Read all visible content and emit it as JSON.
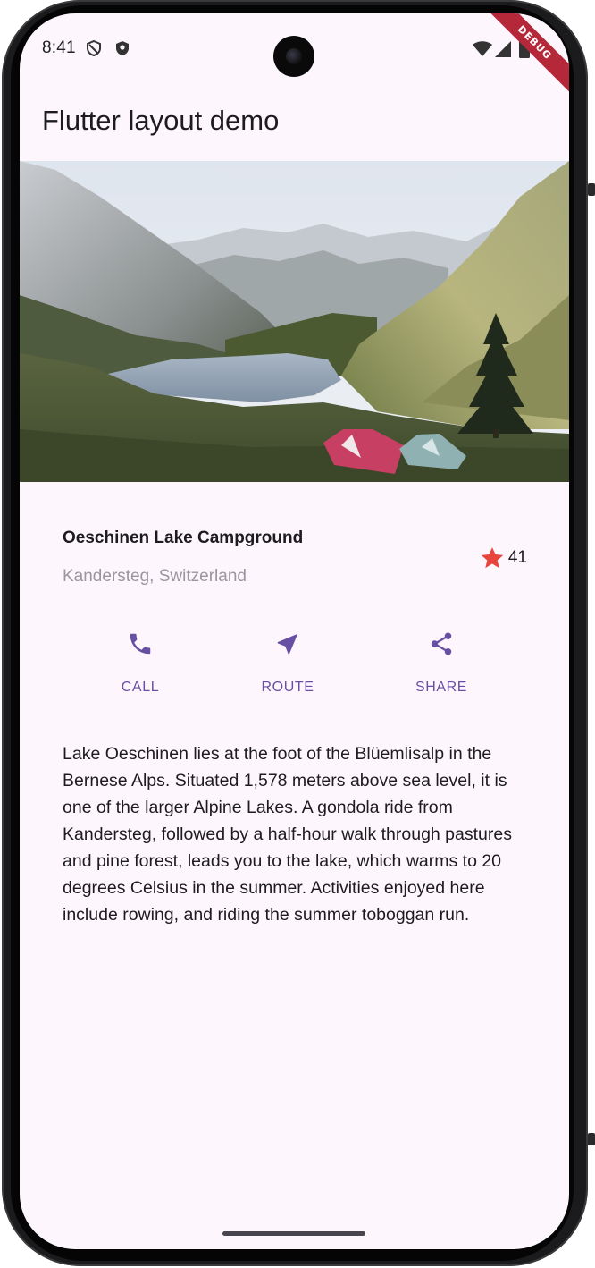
{
  "status_bar": {
    "time": "8:41",
    "left_icons": [
      "shield-outline-icon",
      "shield-filled-icon"
    ],
    "right_icons": [
      "wifi-icon",
      "cellular-icon",
      "battery-icon"
    ],
    "debug_banner": "DEBUG"
  },
  "app_bar": {
    "title": "Flutter layout demo"
  },
  "hero_image": {
    "subject": "mountain lake with tents"
  },
  "title_section": {
    "name": "Oeschinen Lake Campground",
    "location": "Kandersteg, Switzerland",
    "rating_icon": "star-icon",
    "rating_count": "41"
  },
  "buttons": [
    {
      "label": "CALL",
      "icon": "phone-icon"
    },
    {
      "label": "ROUTE",
      "icon": "navigation-icon"
    },
    {
      "label": "SHARE",
      "icon": "share-icon"
    }
  ],
  "description": "Lake Oeschinen lies at the foot of the Blüemlisalp in the Bernese Alps. Situated 1,578 meters above sea level, it is one of the larger Alpine Lakes. A gondola ride from Kandersteg, followed by a half-hour walk through pastures and pine forest, leads you to the lake, which warms to 20 degrees Celsius in the summer. Activities enjoyed here include rowing, and riding the summer toboggan run.",
  "colors": {
    "accent": "#6750a4",
    "star": "#e8453c",
    "background": "#fdf7fd",
    "secondary_text": "#9a959e",
    "debug_banner": "#b4283a"
  }
}
